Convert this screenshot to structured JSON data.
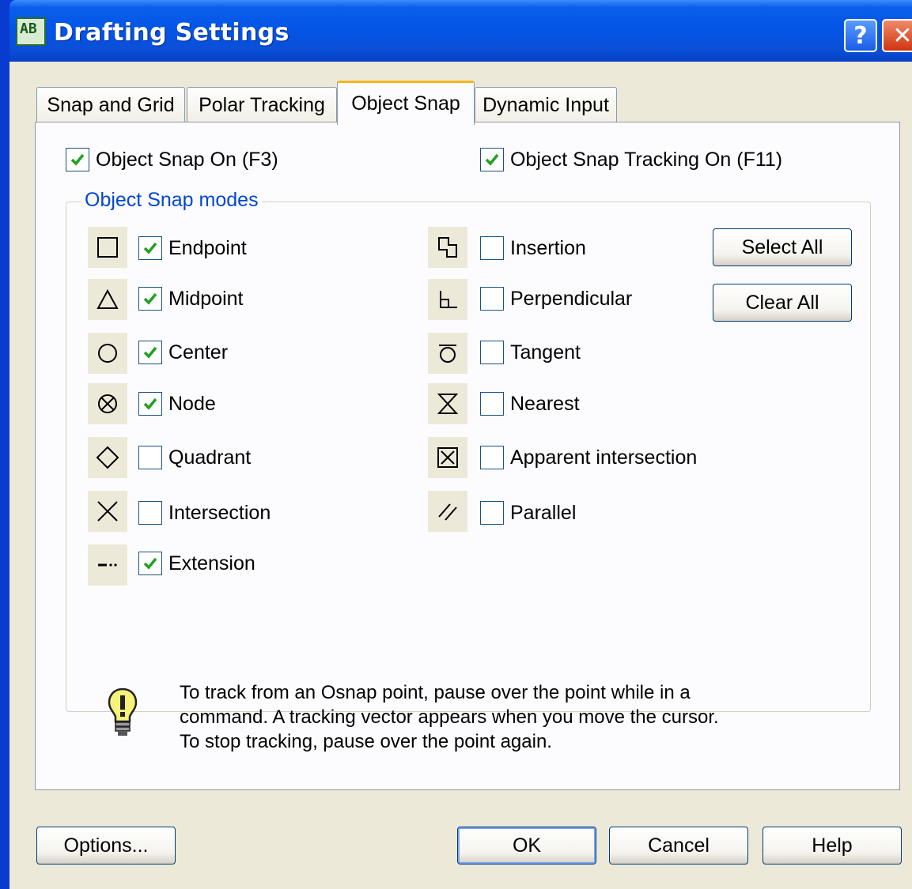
{
  "window": {
    "title": "Drafting Settings",
    "help_label": "?",
    "close_label": "✕"
  },
  "tabs": [
    {
      "label": "Snap and Grid",
      "active": false
    },
    {
      "label": "Polar Tracking",
      "active": false
    },
    {
      "label": "Object Snap",
      "active": true
    },
    {
      "label": "Dynamic Input",
      "active": false
    }
  ],
  "top_options": {
    "snap_on": {
      "label": "Object Snap On (F3)",
      "checked": true
    },
    "tracking_on": {
      "label": "Object Snap Tracking On (F11)",
      "checked": true
    }
  },
  "modes_group": {
    "label": "Object Snap modes",
    "left": [
      {
        "label": "Endpoint",
        "checked": true,
        "icon": "endpoint-square-icon"
      },
      {
        "label": "Midpoint",
        "checked": true,
        "icon": "midpoint-triangle-icon"
      },
      {
        "label": "Center",
        "checked": true,
        "icon": "center-circle-icon"
      },
      {
        "label": "Node",
        "checked": true,
        "icon": "node-icon"
      },
      {
        "label": "Quadrant",
        "checked": false,
        "icon": "quadrant-diamond-icon"
      },
      {
        "label": "Intersection",
        "checked": false,
        "icon": "intersection-x-icon"
      },
      {
        "label": "Extension",
        "checked": true,
        "icon": "extension-icon"
      }
    ],
    "right": [
      {
        "label": "Insertion",
        "checked": false,
        "icon": "insertion-icon"
      },
      {
        "label": "Perpendicular",
        "checked": false,
        "icon": "perpendicular-icon"
      },
      {
        "label": "Tangent",
        "checked": false,
        "icon": "tangent-icon"
      },
      {
        "label": "Nearest",
        "checked": false,
        "icon": "nearest-hourglass-icon"
      },
      {
        "label": "Apparent intersection",
        "checked": false,
        "icon": "apparent-intersection-icon"
      },
      {
        "label": "Parallel",
        "checked": false,
        "icon": "parallel-icon"
      }
    ],
    "select_all": "Select All",
    "clear_all": "Clear All"
  },
  "tip": {
    "icon": "lightbulb-icon",
    "line1": "To track from an Osnap point, pause over the point while in a",
    "line2": "command.  A tracking vector appears when you move the cursor.",
    "line3": "To stop tracking, pause over the point again."
  },
  "footer": {
    "options": "Options...",
    "ok": "OK",
    "cancel": "Cancel",
    "help": "Help"
  },
  "colors": {
    "titlebar": "#0355e6",
    "dialog_bg": "#ece9d8",
    "group_label": "#0046d5",
    "check": "#21a121",
    "active_tab_accent": "#f4b41c"
  }
}
